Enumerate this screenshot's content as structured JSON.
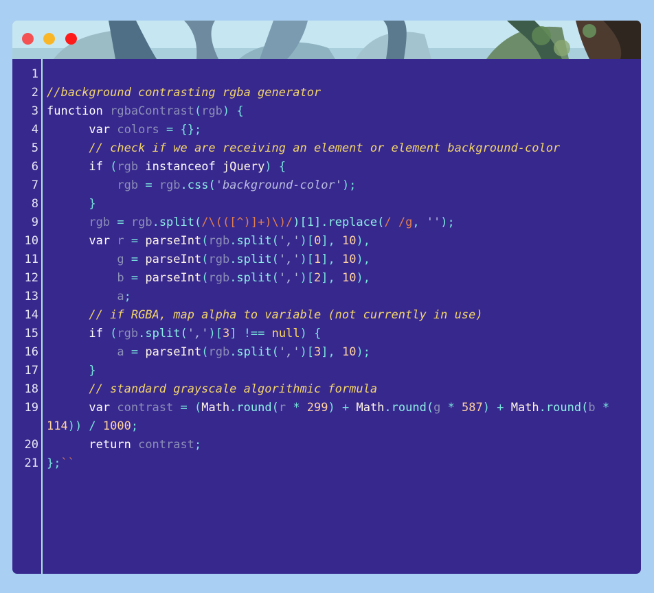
{
  "window": {
    "controls": [
      "close-dot",
      "minimize-dot",
      "maximize-dot"
    ],
    "colors": {
      "close": "#f35152",
      "minimize": "#f9b728",
      "maximize": "#ff1a1a",
      "editor_bg": "#37288d",
      "page_bg": "#a9cff2"
    }
  },
  "editor": {
    "lines": [
      {
        "num": "1",
        "tokens": []
      },
      {
        "num": "2",
        "tokens": [
          {
            "t": "//background contrasting rgba generator",
            "c": "comment"
          }
        ]
      },
      {
        "num": "3",
        "tokens": [
          {
            "t": "function ",
            "c": "kw"
          },
          {
            "t": "rgbaContrast",
            "c": "var"
          },
          {
            "t": "(",
            "c": "punc"
          },
          {
            "t": "rgb",
            "c": "var"
          },
          {
            "t": ") {",
            "c": "punc"
          }
        ]
      },
      {
        "num": "4",
        "tokens": [
          {
            "t": "      "
          },
          {
            "t": "var ",
            "c": "kw"
          },
          {
            "t": "colors",
            "c": "var"
          },
          {
            "t": " = {};",
            "c": "punc"
          }
        ]
      },
      {
        "num": "5",
        "tokens": [
          {
            "t": "      "
          },
          {
            "t": "// check if we are receiving an element or element background-color",
            "c": "comment"
          }
        ]
      },
      {
        "num": "6",
        "tokens": [
          {
            "t": "      "
          },
          {
            "t": "if ",
            "c": "kw"
          },
          {
            "t": "(",
            "c": "punc"
          },
          {
            "t": "rgb",
            "c": "var"
          },
          {
            "t": " instanceof ",
            "c": "kw"
          },
          {
            "t": "jQuery",
            "c": "fn"
          },
          {
            "t": ") {",
            "c": "punc"
          }
        ]
      },
      {
        "num": "7",
        "tokens": [
          {
            "t": "          "
          },
          {
            "t": "rgb",
            "c": "var"
          },
          {
            "t": " = ",
            "c": "punc"
          },
          {
            "t": "rgb",
            "c": "var"
          },
          {
            "t": ".css(",
            "c": "method"
          },
          {
            "t": "'background-color'",
            "c": "str"
          },
          {
            "t": ");",
            "c": "punc"
          }
        ]
      },
      {
        "num": "8",
        "tokens": [
          {
            "t": "      "
          },
          {
            "t": "}",
            "c": "punc"
          }
        ]
      },
      {
        "num": "9",
        "tokens": [
          {
            "t": "      "
          },
          {
            "t": "rgb",
            "c": "var"
          },
          {
            "t": " = ",
            "c": "punc"
          },
          {
            "t": "rgb",
            "c": "var"
          },
          {
            "t": ".split(",
            "c": "method"
          },
          {
            "t": "/\\(([^)]+)\\)/",
            "c": "regex"
          },
          {
            "t": ")[1].replace(",
            "c": "method"
          },
          {
            "t": "/ /g",
            "c": "regex"
          },
          {
            "t": ", ",
            "c": "punc"
          },
          {
            "t": "''",
            "c": "str"
          },
          {
            "t": ");",
            "c": "punc"
          }
        ]
      },
      {
        "num": "10",
        "tokens": [
          {
            "t": "      "
          },
          {
            "t": "var ",
            "c": "kw"
          },
          {
            "t": "r",
            "c": "var"
          },
          {
            "t": " = ",
            "c": "punc"
          },
          {
            "t": "parseInt",
            "c": "fn"
          },
          {
            "t": "(",
            "c": "punc"
          },
          {
            "t": "rgb",
            "c": "var"
          },
          {
            "t": ".split(",
            "c": "method"
          },
          {
            "t": "','",
            "c": "str"
          },
          {
            "t": ")[",
            "c": "punc"
          },
          {
            "t": "0",
            "c": "num"
          },
          {
            "t": "], ",
            "c": "punc"
          },
          {
            "t": "10",
            "c": "num"
          },
          {
            "t": "),",
            "c": "punc"
          }
        ]
      },
      {
        "num": "11",
        "tokens": [
          {
            "t": "          "
          },
          {
            "t": "g",
            "c": "var"
          },
          {
            "t": " = ",
            "c": "punc"
          },
          {
            "t": "parseInt",
            "c": "fn"
          },
          {
            "t": "(",
            "c": "punc"
          },
          {
            "t": "rgb",
            "c": "var"
          },
          {
            "t": ".split(",
            "c": "method"
          },
          {
            "t": "','",
            "c": "str"
          },
          {
            "t": ")[",
            "c": "punc"
          },
          {
            "t": "1",
            "c": "num"
          },
          {
            "t": "], ",
            "c": "punc"
          },
          {
            "t": "10",
            "c": "num"
          },
          {
            "t": "),",
            "c": "punc"
          }
        ]
      },
      {
        "num": "12",
        "tokens": [
          {
            "t": "          "
          },
          {
            "t": "b",
            "c": "var"
          },
          {
            "t": " = ",
            "c": "punc"
          },
          {
            "t": "parseInt",
            "c": "fn"
          },
          {
            "t": "(",
            "c": "punc"
          },
          {
            "t": "rgb",
            "c": "var"
          },
          {
            "t": ".split(",
            "c": "method"
          },
          {
            "t": "','",
            "c": "str"
          },
          {
            "t": ")[",
            "c": "punc"
          },
          {
            "t": "2",
            "c": "num"
          },
          {
            "t": "], ",
            "c": "punc"
          },
          {
            "t": "10",
            "c": "num"
          },
          {
            "t": "),",
            "c": "punc"
          }
        ]
      },
      {
        "num": "13",
        "tokens": [
          {
            "t": "          "
          },
          {
            "t": "a",
            "c": "var"
          },
          {
            "t": ";",
            "c": "punc"
          }
        ]
      },
      {
        "num": "14",
        "tokens": [
          {
            "t": "      "
          },
          {
            "t": "// if RGBA, map alpha to variable (not currently in use)",
            "c": "comment"
          }
        ]
      },
      {
        "num": "15",
        "tokens": [
          {
            "t": "      "
          },
          {
            "t": "if ",
            "c": "kw"
          },
          {
            "t": "(",
            "c": "punc"
          },
          {
            "t": "rgb",
            "c": "var"
          },
          {
            "t": ".split(",
            "c": "method"
          },
          {
            "t": "','",
            "c": "str"
          },
          {
            "t": ")[",
            "c": "punc"
          },
          {
            "t": "3",
            "c": "num"
          },
          {
            "t": "] !== ",
            "c": "punc"
          },
          {
            "t": "null",
            "c": "null"
          },
          {
            "t": ") {",
            "c": "punc"
          }
        ]
      },
      {
        "num": "16",
        "tokens": [
          {
            "t": "          "
          },
          {
            "t": "a",
            "c": "var"
          },
          {
            "t": " = ",
            "c": "punc"
          },
          {
            "t": "parseInt",
            "c": "fn"
          },
          {
            "t": "(",
            "c": "punc"
          },
          {
            "t": "rgb",
            "c": "var"
          },
          {
            "t": ".split(",
            "c": "method"
          },
          {
            "t": "','",
            "c": "str"
          },
          {
            "t": ")[",
            "c": "punc"
          },
          {
            "t": "3",
            "c": "num"
          },
          {
            "t": "], ",
            "c": "punc"
          },
          {
            "t": "10",
            "c": "num"
          },
          {
            "t": ");",
            "c": "punc"
          }
        ]
      },
      {
        "num": "17",
        "tokens": [
          {
            "t": "      "
          },
          {
            "t": "}",
            "c": "punc"
          }
        ]
      },
      {
        "num": "18",
        "tokens": [
          {
            "t": "      "
          },
          {
            "t": "// standard grayscale algorithmic formula",
            "c": "comment"
          }
        ]
      },
      {
        "num": "19",
        "tokens": [
          {
            "t": "      "
          },
          {
            "t": "var ",
            "c": "kw"
          },
          {
            "t": "contrast",
            "c": "var"
          },
          {
            "t": " = (",
            "c": "punc"
          },
          {
            "t": "Math",
            "c": "fn"
          },
          {
            "t": ".round(",
            "c": "method"
          },
          {
            "t": "r",
            "c": "var"
          },
          {
            "t": " * ",
            "c": "punc"
          },
          {
            "t": "299",
            "c": "num"
          },
          {
            "t": ") + ",
            "c": "punc"
          },
          {
            "t": "Math",
            "c": "fn"
          },
          {
            "t": ".round(",
            "c": "method"
          },
          {
            "t": "g",
            "c": "var"
          },
          {
            "t": " * ",
            "c": "punc"
          },
          {
            "t": "587",
            "c": "num"
          },
          {
            "t": ") + ",
            "c": "punc"
          },
          {
            "t": "Math",
            "c": "fn"
          },
          {
            "t": ".round(",
            "c": "method"
          },
          {
            "t": "b",
            "c": "var"
          },
          {
            "t": " *",
            "c": "punc"
          }
        ]
      },
      {
        "num": "",
        "tokens": [
          {
            "t": "114",
            "c": "num"
          },
          {
            "t": ")) / ",
            "c": "punc"
          },
          {
            "t": "1000",
            "c": "num"
          },
          {
            "t": ";",
            "c": "punc"
          }
        ]
      },
      {
        "num": "20",
        "tokens": [
          {
            "t": "      "
          },
          {
            "t": "return ",
            "c": "kw"
          },
          {
            "t": "contrast",
            "c": "var"
          },
          {
            "t": ";",
            "c": "punc"
          }
        ]
      },
      {
        "num": "21",
        "tokens": [
          {
            "t": "};",
            "c": "punc"
          },
          {
            "t": "``",
            "c": "regex"
          }
        ]
      }
    ]
  }
}
